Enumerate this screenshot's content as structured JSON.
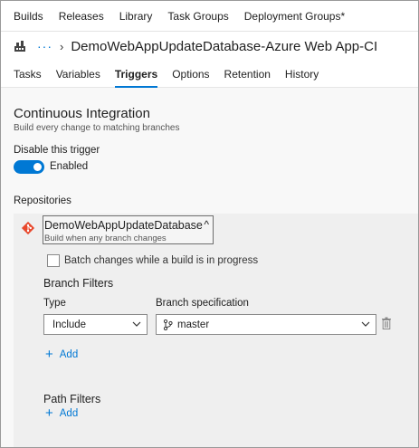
{
  "topnav": {
    "items": [
      "Builds",
      "Releases",
      "Library",
      "Task Groups",
      "Deployment Groups*"
    ]
  },
  "titlebar": {
    "ellipsis": "···",
    "separator": "›",
    "title": "DemoWebAppUpdateDatabase-Azure Web App-CI"
  },
  "tabs": {
    "items": [
      "Tasks",
      "Variables",
      "Triggers",
      "Options",
      "Retention",
      "History"
    ],
    "active": "Triggers"
  },
  "ci": {
    "title": "Continuous Integration",
    "subtitle": "Build every change to matching branches",
    "disable_label": "Disable this trigger",
    "toggle_state": "Enabled",
    "toggle_on": true
  },
  "repositories": {
    "label": "Repositories",
    "repo_name": "DemoWebAppUpdateDatabase",
    "repo_caret": "^",
    "repo_sub": "Build when any branch changes",
    "batch_label": "Batch changes while a build is in progress",
    "batch_checked": false
  },
  "branch_filters": {
    "title": "Branch Filters",
    "type_label": "Type",
    "spec_label": "Branch specification",
    "type_value": "Include",
    "spec_value": "master",
    "add_label": "Add"
  },
  "path_filters": {
    "title": "Path Filters",
    "add_label": "Add"
  },
  "colors": {
    "accent": "#0078d4",
    "git_icon": "#e8482c"
  },
  "icons": {
    "build": "build-pipeline-icon",
    "git": "git-icon",
    "branch": "branch-icon",
    "chevron": "chevron-down-icon",
    "trash": "trash-icon",
    "plus": "plus-icon"
  }
}
